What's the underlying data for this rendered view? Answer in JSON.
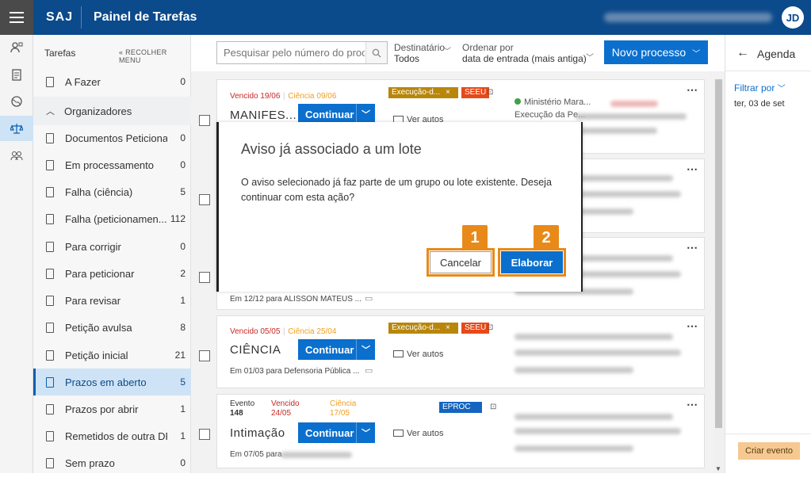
{
  "header": {
    "brand": "SAJ",
    "title": "Painel de Tarefas",
    "avatar": "JD"
  },
  "sidebar": {
    "heading": "Tarefas",
    "collapse_label": "« RECOLHER MENU",
    "items": [
      {
        "label": "A Fazer",
        "count": "0"
      },
      {
        "label": "Organizadores",
        "count": ""
      },
      {
        "label": "Documentos Peticiona...",
        "count": "0"
      },
      {
        "label": "Em processamento",
        "count": "0"
      },
      {
        "label": "Falha (ciência)",
        "count": "5"
      },
      {
        "label": "Falha (peticionamen...",
        "count": "112"
      },
      {
        "label": "Para corrigir",
        "count": "0"
      },
      {
        "label": "Para peticionar",
        "count": "2"
      },
      {
        "label": "Para revisar",
        "count": "1"
      },
      {
        "label": "Petição avulsa",
        "count": "8"
      },
      {
        "label": "Petição inicial",
        "count": "21"
      },
      {
        "label": "Prazos em aberto",
        "count": "5"
      },
      {
        "label": "Prazos por abrir",
        "count": "1"
      },
      {
        "label": "Remetidos de outra DP",
        "count": "1"
      },
      {
        "label": "Sem prazo",
        "count": "0"
      }
    ]
  },
  "toolbar": {
    "search_placeholder": "Pesquisar pelo número do processo",
    "dest_label": "Destinatário",
    "dest_value": "Todos",
    "order_label": "Ordenar por",
    "order_value": "data de entrada (mais antiga)",
    "new_process": "Novo processo"
  },
  "cards": [
    {
      "vencido": "Vencido 19/06",
      "ciencia": "Ciência 09/06",
      "tag1": "Execução-d...",
      "tag2": "SEEU",
      "title": "MANIFES...",
      "continue": "Continuar",
      "ver": "Ver autos",
      "org": "Ministério Mara...",
      "proc": "Execução da Pe..."
    },
    {
      "foot": "Em 12/12 para ALISSON MATEUS ..."
    },
    {
      "vencido": "Vencido 05/05",
      "ciencia": "Ciência 25/04",
      "tag1": "Execução-d...",
      "tag2": "SEEU",
      "title": "CIÊNCIA",
      "continue": "Continuar",
      "ver": "Ver autos",
      "foot": "Em 01/03 para Defensoria Pública ..."
    },
    {
      "evento_label": "Evento",
      "evento_num": "148",
      "vencido_l": "Vencido",
      "vencido_d": "24/05",
      "ciencia_l": "Ciência",
      "ciencia_d": "17/05",
      "tag": "EPROC",
      "title": "Intimação",
      "continue": "Continuar",
      "ver": "Ver autos",
      "foot": "Em 07/05 para"
    }
  ],
  "agenda": {
    "title": "Agenda",
    "filter": "Filtrar por",
    "date": "ter, 03 de set",
    "create": "Criar evento"
  },
  "modal": {
    "title": "Aviso já associado a um lote",
    "body": "O aviso selecionado já faz parte de um grupo ou lote existente. Deseja continuar com esta ação?",
    "cancel": "Cancelar",
    "confirm": "Elaborar",
    "badge1": "1",
    "badge2": "2"
  },
  "colors": {
    "header": "#0b4a8b",
    "primary": "#0b6fce",
    "highlight": "#e88a1a"
  }
}
